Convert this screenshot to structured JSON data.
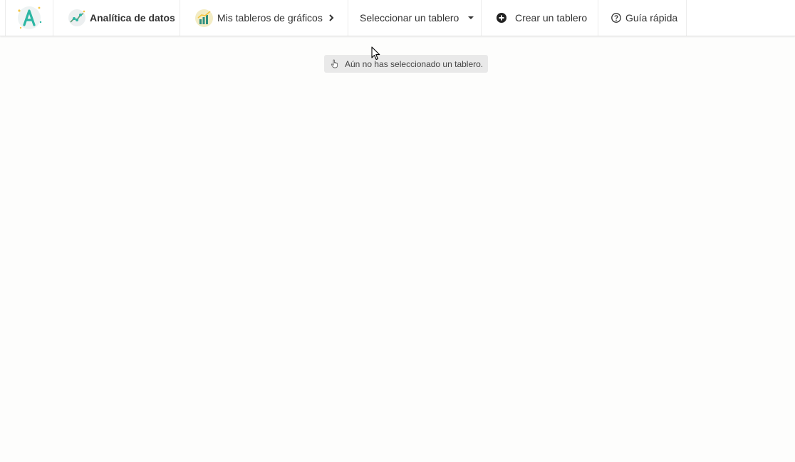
{
  "topbar": {
    "logo_icon": "app-logo-a-icon",
    "analytics": {
      "label": "Analítica de datos",
      "icon": "line-chart-icon"
    },
    "my_boards": {
      "label": "Mis tableros de gráficos",
      "icon": "bar-chart-icon"
    },
    "select_board": {
      "label": "Seleccionar un tablero"
    },
    "create_board": {
      "label": "Crear un tablero",
      "icon": "plus-circle-icon"
    },
    "quick_guide": {
      "label": "Guía rápida",
      "icon": "help-circle-icon"
    }
  },
  "notice": {
    "text": "Aún no has seleccionado un tablero.",
    "icon": "pointing-hand-icon"
  },
  "colors": {
    "accent_teal": "#2bb6a3",
    "accent_yellow": "#f4c542",
    "notice_bg": "#e9e9e9"
  }
}
